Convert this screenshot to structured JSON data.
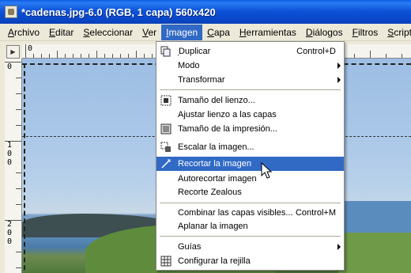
{
  "window": {
    "title": "*cadenas.jpg-6.0 (RGB, 1 capa) 560x420"
  },
  "menubar": {
    "items": [
      {
        "label": "Archivo",
        "key": "A"
      },
      {
        "label": "Editar",
        "key": "E"
      },
      {
        "label": "Seleccionar",
        "key": "S"
      },
      {
        "label": "Ver",
        "key": "V"
      },
      {
        "label": "Imagen",
        "key": "I"
      },
      {
        "label": "Capa",
        "key": "C"
      },
      {
        "label": "Herramientas",
        "key": "H"
      },
      {
        "label": "Diálogos",
        "key": "D"
      },
      {
        "label": "Filtros",
        "key": "F"
      },
      {
        "label": "Script-Fu",
        "key": "S"
      }
    ],
    "active": "Imagen"
  },
  "rulers": {
    "top_label": "0",
    "left_labels": [
      "0",
      "100",
      "200"
    ]
  },
  "menu": {
    "items": [
      {
        "label": "Duplicar",
        "shortcut": "Control+D",
        "icon": "duplicate-icon"
      },
      {
        "label": "Modo",
        "submenu": true
      },
      {
        "label": "Transformar",
        "submenu": true
      },
      {
        "label": "Tamaño del lienzo...",
        "icon": "canvas-size-icon"
      },
      {
        "label": "Ajustar lienzo a las capas"
      },
      {
        "label": "Tamaño de la impresión...",
        "icon": "print-size-icon"
      },
      {
        "label": "Escalar la imagen...",
        "icon": "scale-image-icon"
      },
      {
        "label": "Recortar la imagen",
        "icon": "crop-icon",
        "highlighted": true
      },
      {
        "label": "Autorecortar imagen"
      },
      {
        "label": "Recorte Zealous"
      },
      {
        "label": "Combinar las capas visibles...",
        "shortcut": "Control+M"
      },
      {
        "label": "Aplanar la imagen"
      },
      {
        "label": "Guías",
        "submenu": true
      },
      {
        "label": "Configurar la rejilla",
        "icon": "grid-icon"
      }
    ]
  },
  "colors": {
    "title_bar": "#0a53d9",
    "highlight": "#316ac5",
    "menu_bg": "#ece9d8"
  }
}
